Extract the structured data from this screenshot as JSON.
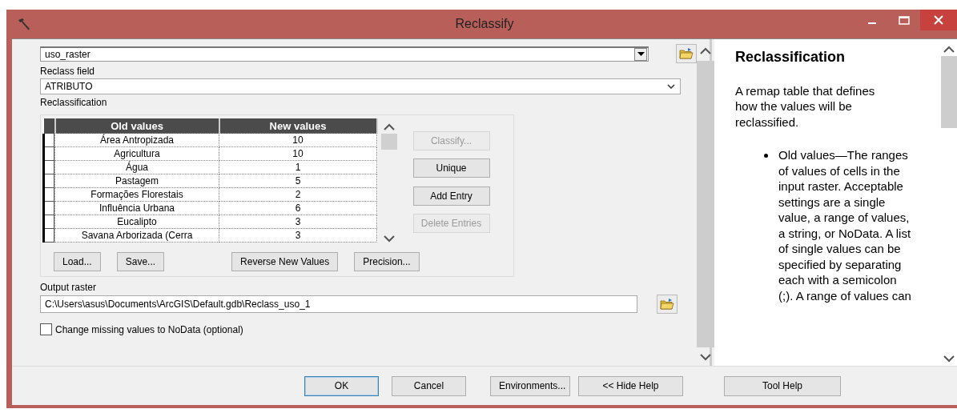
{
  "window": {
    "title": "Reclassify"
  },
  "input_raster": {
    "value": "uso_raster"
  },
  "reclass_field": {
    "label": "Reclass field",
    "value": "ATRIBUTO"
  },
  "reclassification": {
    "label": "Reclassification",
    "columns": [
      "Old values",
      "New values"
    ],
    "rows": [
      {
        "old": "Área Antropizada",
        "new": "10"
      },
      {
        "old": "Agricultura",
        "new": "10"
      },
      {
        "old": "Água",
        "new": "1"
      },
      {
        "old": "Pastagem",
        "new": "5"
      },
      {
        "old": "Formações Florestais",
        "new": "2"
      },
      {
        "old": "Influência Urbana",
        "new": "6"
      },
      {
        "old": "Eucalipto",
        "new": "3"
      },
      {
        "old": "Savana Arborizada (Cerra",
        "new": "3"
      }
    ],
    "side_buttons": [
      {
        "label": "Classify...",
        "disabled": true
      },
      {
        "label": "Unique",
        "disabled": false
      },
      {
        "label": "Add Entry",
        "disabled": false
      },
      {
        "label": "Delete Entries",
        "disabled": true
      }
    ],
    "bottom_buttons": [
      {
        "label": "Load..."
      },
      {
        "label": "Save..."
      },
      {
        "label": "Reverse New Values"
      },
      {
        "label": "Precision..."
      }
    ]
  },
  "output_raster": {
    "label": "Output raster",
    "value": "C:\\Users\\asus\\Documents\\ArcGIS\\Default.gdb\\Reclass_uso_1"
  },
  "missing_values": {
    "label": "Change missing values to NoData (optional)",
    "checked": false
  },
  "buttons": [
    {
      "label": "OK",
      "default": true
    },
    {
      "label": "Cancel",
      "default": false
    },
    {
      "label": "Environments...",
      "default": false
    },
    {
      "label": "<< Hide Help",
      "default": false
    },
    {
      "label": "Tool Help",
      "default": false
    }
  ],
  "help": {
    "title": "Reclassification",
    "intro": "A remap table that defines how the values will be reclassified.",
    "bullets": [
      "Old values—The ranges of values of cells in the input raster. Acceptable settings are a single value, a range of values, a string, or NoData. A list of single values can be specified by separating each with a semicolon (;). A range of values can"
    ]
  }
}
